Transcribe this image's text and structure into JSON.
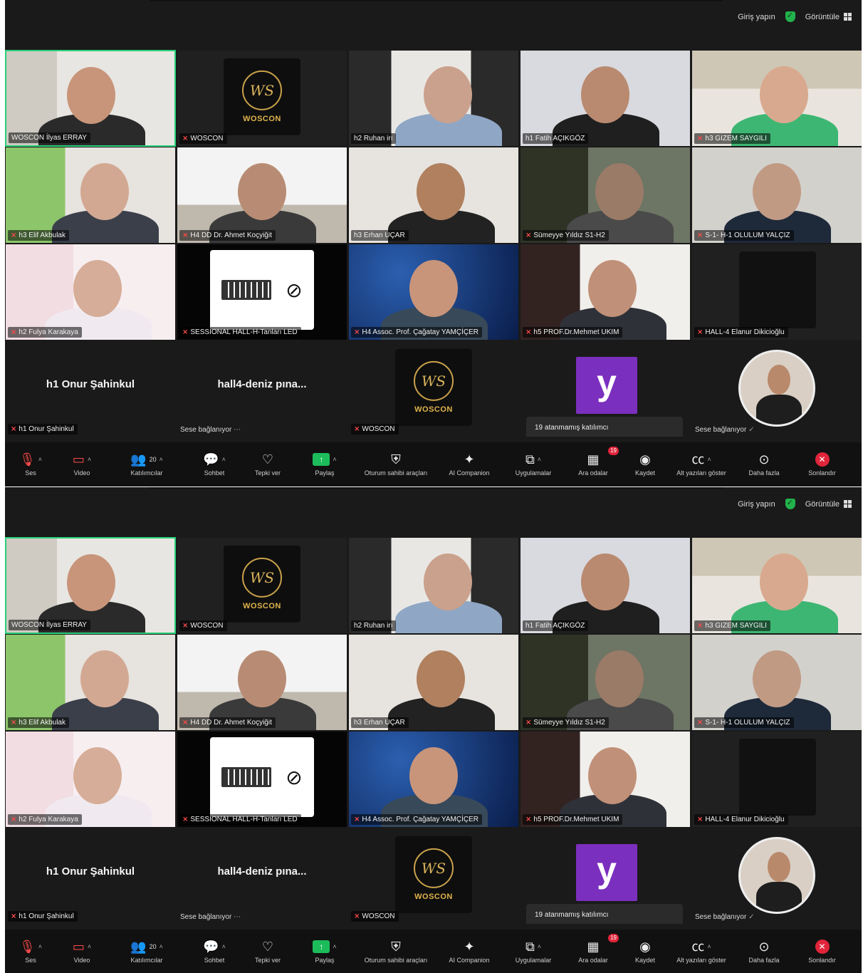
{
  "topbar": {
    "signin": "Giriş yapın",
    "view": "Görüntüle"
  },
  "tiles": [
    {
      "name": "WOSCON İlyas ERRAY",
      "muted": false,
      "kind": "video",
      "speaking": true
    },
    {
      "name": "WOSCON",
      "muted": true,
      "kind": "logo"
    },
    {
      "name": "h2 Ruhan irı",
      "muted": false,
      "kind": "video"
    },
    {
      "name": "h1 Fatih AÇIKGÖZ",
      "muted": false,
      "kind": "video"
    },
    {
      "name": "h3 GIZEM SAYGILI",
      "muted": true,
      "kind": "video"
    },
    {
      "name": "h3 Elif Akbulak",
      "muted": true,
      "kind": "video"
    },
    {
      "name": "H4 DD Dr. Ahmet Koçyiğit",
      "muted": true,
      "kind": "video"
    },
    {
      "name": "h3 Erhan UÇAR",
      "muted": false,
      "kind": "video"
    },
    {
      "name": "Sümeyye Yıldız S1-H2",
      "muted": true,
      "kind": "video"
    },
    {
      "name": "S-1- H-1 OLULUM YALÇIZ",
      "muted": true,
      "kind": "video"
    },
    {
      "name": "h2 Fulya Karakaya",
      "muted": true,
      "kind": "video"
    },
    {
      "name": "SESSİONAL HALL-H-Tanları LED",
      "muted": true,
      "kind": "keyboard"
    },
    {
      "name": "H4 Assoc. Prof. Çağatay YAMÇİÇER",
      "muted": true,
      "kind": "video"
    },
    {
      "name": "h5 PROF.Dr.Mehmet UKIM",
      "muted": true,
      "kind": "video"
    },
    {
      "name": "HALL-4 Elanur Dikicioğlu",
      "muted": true,
      "kind": "dark"
    }
  ],
  "row4": {
    "onur": {
      "big_name": "h1 Onur Şahinkul",
      "tag": "h1 Onur Şahinkul"
    },
    "deniz": {
      "big_name": "hall4-deniz pına...",
      "status": "Sese bağlanıyor"
    },
    "woscon": {
      "tag": "WOSCON"
    },
    "y": {
      "letter": "y",
      "unassigned": "19 atanmamış katılımcı"
    },
    "last": {
      "status": "Sese bağlanıyor"
    }
  },
  "logo_text": "WOSCON",
  "toolbar": [
    {
      "id": "ses",
      "label": "Ses",
      "icon": "mic-off-icon"
    },
    {
      "id": "video",
      "label": "Video",
      "icon": "video-off-icon"
    },
    {
      "id": "participants",
      "label": "Katılımcılar",
      "icon": "participants-icon",
      "count": "20"
    },
    {
      "id": "chat",
      "label": "Sohbet",
      "icon": "chat-icon"
    },
    {
      "id": "react",
      "label": "Tepki ver",
      "icon": "heart-icon"
    },
    {
      "id": "share",
      "label": "Paylaş",
      "icon": "share-icon"
    },
    {
      "id": "host",
      "label": "Oturum sahibi araçları",
      "icon": "shield-icon"
    },
    {
      "id": "ai",
      "label": "AI Companion",
      "icon": "sparkle-icon"
    },
    {
      "id": "apps",
      "label": "Uygulamalar",
      "icon": "apps-icon"
    },
    {
      "id": "rooms",
      "label": "Ara odalar",
      "icon": "breakout-icon",
      "badge": "19"
    },
    {
      "id": "record",
      "label": "Kaydet",
      "icon": "record-icon"
    },
    {
      "id": "cc",
      "label": "Alt yazıları göster",
      "icon": "cc-icon"
    },
    {
      "id": "more",
      "label": "Daha fazla",
      "icon": "more-icon"
    },
    {
      "id": "end",
      "label": "Sonlandır",
      "icon": "end-icon"
    }
  ]
}
